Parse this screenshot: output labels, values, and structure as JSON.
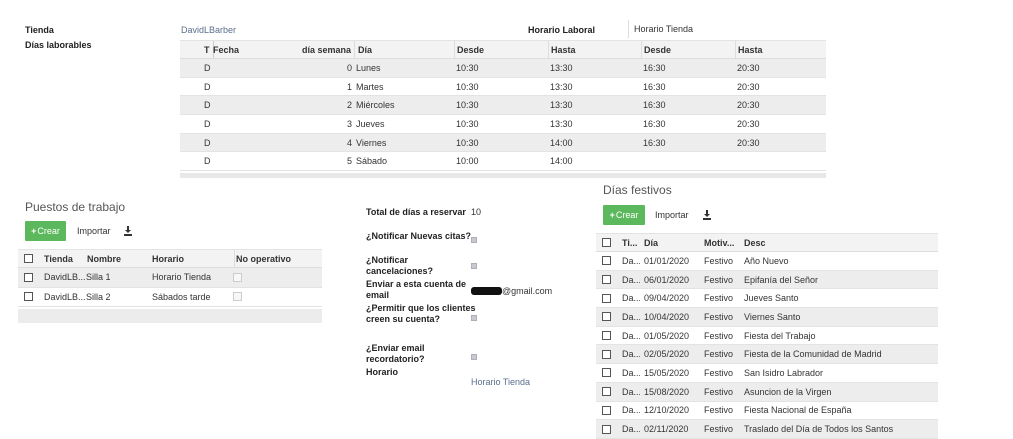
{
  "info": {
    "tienda_label": "Tienda",
    "tienda_value": "DavidLBarber",
    "dias_label": "Días laborables",
    "horario_laboral": "Horario Laboral",
    "horario_tienda": "Horario Tienda"
  },
  "schedule": {
    "columns": [
      "T",
      "Fecha",
      "día semana",
      "Día",
      "Desde",
      "Hasta",
      "Desde",
      "Hasta"
    ],
    "rows": [
      {
        "t": "D",
        "num": "0",
        "dia": "Lunes",
        "d1": "10:30",
        "h1": "13:30",
        "d2": "16:30",
        "h2": "20:30"
      },
      {
        "t": "D",
        "num": "1",
        "dia": "Martes",
        "d1": "10:30",
        "h1": "13:30",
        "d2": "16:30",
        "h2": "20:30"
      },
      {
        "t": "D",
        "num": "2",
        "dia": "Miércoles",
        "d1": "10:30",
        "h1": "13:30",
        "d2": "16:30",
        "h2": "20:30"
      },
      {
        "t": "D",
        "num": "3",
        "dia": "Jueves",
        "d1": "10:30",
        "h1": "13:30",
        "d2": "16:30",
        "h2": "20:30"
      },
      {
        "t": "D",
        "num": "4",
        "dia": "Viernes",
        "d1": "10:30",
        "h1": "14:00",
        "d2": "16:30",
        "h2": "20:30"
      },
      {
        "t": "D",
        "num": "5",
        "dia": "Sábado",
        "d1": "10:00",
        "h1": "14:00",
        "d2": "",
        "h2": ""
      }
    ]
  },
  "puestos": {
    "title": "Puestos de trabajo",
    "create": "Crear",
    "import": "Importar",
    "columns": [
      "Tienda",
      "Nombre",
      "Horario",
      "No operativo"
    ],
    "rows": [
      {
        "tienda": "DavidLB...",
        "nombre": "Silla 1",
        "horario": "Horario Tienda"
      },
      {
        "tienda": "DavidLB...",
        "nombre": "Silla 2",
        "horario": "Sábados tarde"
      }
    ]
  },
  "config": {
    "total_label": "Total de días a reservar",
    "total_value": "10",
    "notif_citas_label": "¿Notificar Nuevas citas?",
    "notif_cancel_label": "¿Notificar cancelaciones?",
    "email_label": "Enviar a esta cuenta de email",
    "email_value": "@gmail.com",
    "permitir_label": "¿Permitir que los clientes creen su cuenta?",
    "recordatorio_label": "¿Enviar email recordatorio?",
    "horario_label": "Horario",
    "horario_value": "Horario Tienda"
  },
  "festivos": {
    "title": "Días festivos",
    "create": "Crear",
    "import": "Importar",
    "columns": [
      "Ti...",
      "Día",
      "Motiv...",
      "Desc"
    ],
    "rows": [
      {
        "t": "Da...",
        "dia": "01/01/2020",
        "motivo": "Festivo",
        "desc": "Año Nuevo"
      },
      {
        "t": "Da...",
        "dia": "06/01/2020",
        "motivo": "Festivo",
        "desc": "Epifanía del Señor"
      },
      {
        "t": "Da...",
        "dia": "09/04/2020",
        "motivo": "Festivo",
        "desc": "Jueves Santo"
      },
      {
        "t": "Da...",
        "dia": "10/04/2020",
        "motivo": "Festivo",
        "desc": "Viernes Santo"
      },
      {
        "t": "Da...",
        "dia": "01/05/2020",
        "motivo": "Festivo",
        "desc": "Fiesta del Trabajo"
      },
      {
        "t": "Da...",
        "dia": "02/05/2020",
        "motivo": "Festivo",
        "desc": "Fiesta de la Comunidad de Madrid"
      },
      {
        "t": "Da...",
        "dia": "15/05/2020",
        "motivo": "Festivo",
        "desc": "San Isidro Labrador"
      },
      {
        "t": "Da...",
        "dia": "15/08/2020",
        "motivo": "Festivo",
        "desc": "Asuncion de la Virgen"
      },
      {
        "t": "Da...",
        "dia": "12/10/2020",
        "motivo": "Festivo",
        "desc": "Fiesta Nacional de España"
      },
      {
        "t": "Da...",
        "dia": "02/11/2020",
        "motivo": "Festivo",
        "desc": "Traslado del Día de Todos los Santos"
      }
    ]
  }
}
